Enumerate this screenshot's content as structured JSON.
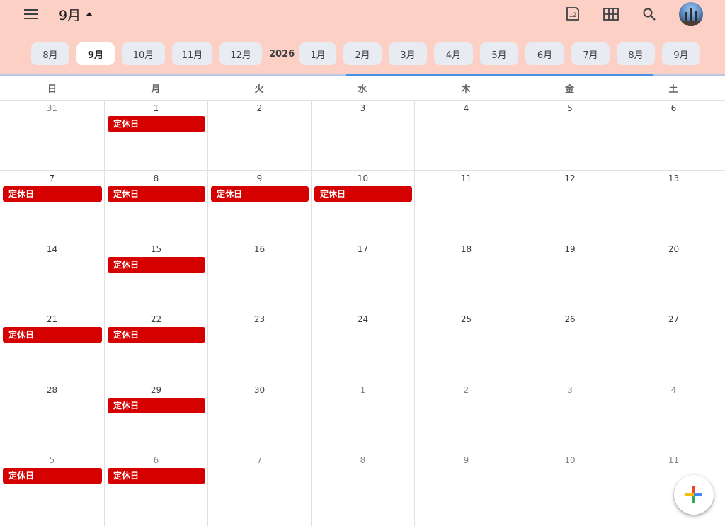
{
  "header": {
    "current_month": "9月",
    "year": "2026",
    "today_icon_date": "12",
    "icons": [
      "menu-icon",
      "dropdown-caret-icon",
      "today-calendar-icon",
      "grid-view-icon",
      "search-icon",
      "avatar"
    ]
  },
  "month_strip": {
    "chips": [
      "8月",
      "9月",
      "10月",
      "11月",
      "12月",
      "1月",
      "2月",
      "3月",
      "4月",
      "5月",
      "6月",
      "7月",
      "8月",
      "9月"
    ],
    "active_index": 1
  },
  "weekdays": [
    "日",
    "月",
    "火",
    "水",
    "木",
    "金",
    "土"
  ],
  "weeks": [
    [
      {
        "day": "31",
        "other": true,
        "event": ""
      },
      {
        "day": "1",
        "other": false,
        "event": "定休日"
      },
      {
        "day": "2",
        "other": false,
        "event": ""
      },
      {
        "day": "3",
        "other": false,
        "event": ""
      },
      {
        "day": "4",
        "other": false,
        "event": ""
      },
      {
        "day": "5",
        "other": false,
        "event": ""
      },
      {
        "day": "6",
        "other": false,
        "event": ""
      }
    ],
    [
      {
        "day": "7",
        "other": false,
        "event": "定休日"
      },
      {
        "day": "8",
        "other": false,
        "event": "定休日"
      },
      {
        "day": "9",
        "other": false,
        "event": "定休日"
      },
      {
        "day": "10",
        "other": false,
        "event": "定休日"
      },
      {
        "day": "11",
        "other": false,
        "event": ""
      },
      {
        "day": "12",
        "other": false,
        "event": ""
      },
      {
        "day": "13",
        "other": false,
        "event": ""
      }
    ],
    [
      {
        "day": "14",
        "other": false,
        "event": ""
      },
      {
        "day": "15",
        "other": false,
        "event": "定休日"
      },
      {
        "day": "16",
        "other": false,
        "event": ""
      },
      {
        "day": "17",
        "other": false,
        "event": ""
      },
      {
        "day": "18",
        "other": false,
        "event": ""
      },
      {
        "day": "19",
        "other": false,
        "event": ""
      },
      {
        "day": "20",
        "other": false,
        "event": ""
      }
    ],
    [
      {
        "day": "21",
        "other": false,
        "event": "定休日"
      },
      {
        "day": "22",
        "other": false,
        "event": "定休日"
      },
      {
        "day": "23",
        "other": false,
        "event": ""
      },
      {
        "day": "24",
        "other": false,
        "event": ""
      },
      {
        "day": "25",
        "other": false,
        "event": ""
      },
      {
        "day": "26",
        "other": false,
        "event": ""
      },
      {
        "day": "27",
        "other": false,
        "event": ""
      }
    ],
    [
      {
        "day": "28",
        "other": false,
        "event": ""
      },
      {
        "day": "29",
        "other": false,
        "event": "定休日"
      },
      {
        "day": "30",
        "other": false,
        "event": ""
      },
      {
        "day": "1",
        "other": true,
        "event": ""
      },
      {
        "day": "2",
        "other": true,
        "event": ""
      },
      {
        "day": "3",
        "other": true,
        "event": ""
      },
      {
        "day": "4",
        "other": true,
        "event": ""
      }
    ],
    [
      {
        "day": "5",
        "other": true,
        "event": "定休日"
      },
      {
        "day": "6",
        "other": true,
        "event": "定休日"
      },
      {
        "day": "7",
        "other": true,
        "event": ""
      },
      {
        "day": "8",
        "other": true,
        "event": ""
      },
      {
        "day": "9",
        "other": true,
        "event": ""
      },
      {
        "day": "10",
        "other": true,
        "event": ""
      },
      {
        "day": "11",
        "other": true,
        "event": ""
      }
    ]
  ],
  "colors": {
    "header_bg": "#fcd0c4",
    "event_bg": "#d50000",
    "chip_bg": "#e8ebf1",
    "accent_line": "#4a8ee6"
  },
  "fab": {
    "icon": "create-plus-icon"
  }
}
